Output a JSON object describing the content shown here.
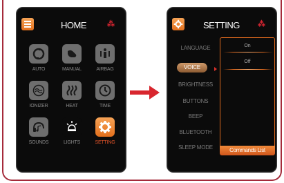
{
  "home": {
    "title": "HOME",
    "tiles": [
      {
        "label": "AUTO",
        "icon": "auto-icon"
      },
      {
        "label": "MANUAL",
        "icon": "manual-icon"
      },
      {
        "label": "AIRBAG",
        "icon": "airbag-icon"
      },
      {
        "label": "IONIZER",
        "icon": "ionizer-icon"
      },
      {
        "label": "HEAT",
        "icon": "heat-icon"
      },
      {
        "label": "TIME",
        "icon": "clock-icon"
      },
      {
        "label": "SOUNDS",
        "icon": "sounds-icon"
      },
      {
        "label": "LIGHTS",
        "icon": "lights-icon"
      },
      {
        "label": "SETTING",
        "icon": "gear-icon",
        "active": true
      }
    ]
  },
  "setting": {
    "title": "SETTING",
    "items": [
      "LANGUAGE",
      "VOICE",
      "BRIGHTNESS",
      "BUTTONS",
      "BEEP",
      "BLUETOOTH",
      "SLEEP MODE"
    ],
    "selected": "VOICE",
    "options": [
      "On",
      "Off"
    ],
    "commands_label": "Commands List"
  },
  "colors": {
    "accent": "#e36f1c",
    "frame": "#a52a3a",
    "arrow": "#d8262e"
  }
}
